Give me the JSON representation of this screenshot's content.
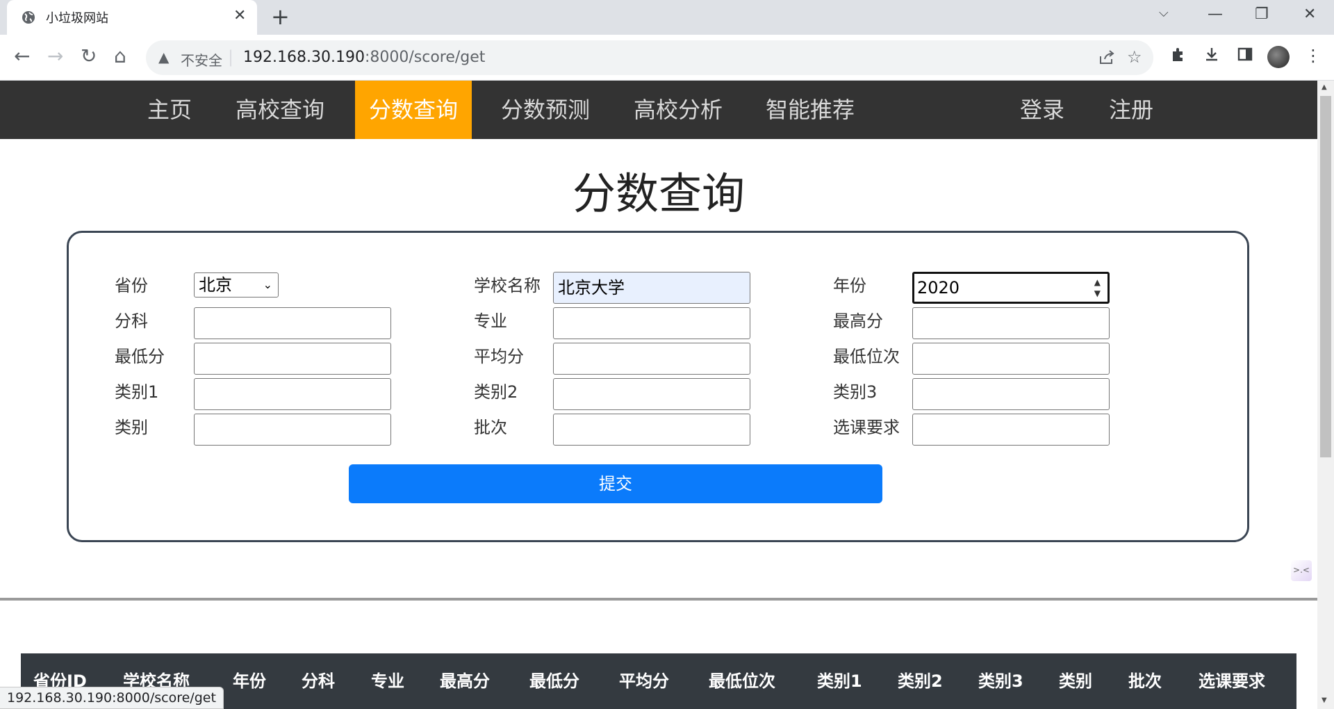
{
  "browser": {
    "tab_title": "小垃圾网站",
    "tab_close": "✕",
    "new_tab": "+",
    "window": {
      "chevron": "⌵",
      "minimize": "—",
      "restore": "❐",
      "close": "✕"
    },
    "nav": {
      "back": "←",
      "forward": "→",
      "reload": "↻",
      "home": "⌂"
    },
    "security_icon": "▲",
    "insecure_label": "不安全",
    "separator": "|",
    "url_host": "192.168.30.190",
    "url_path": ":8000/score/get",
    "status_url": "192.168.30.190:8000/score/get"
  },
  "navbar": {
    "items": [
      "主页",
      "高校查询",
      "分数查询",
      "分数预测",
      "高校分析",
      "智能推荐"
    ],
    "active_index": 2,
    "login": "登录",
    "register": "注册"
  },
  "page_title": "分数查询",
  "form": {
    "labels": {
      "province": "省份",
      "school": "学校名称",
      "year": "年份",
      "subject": "分科",
      "major": "专业",
      "max_score": "最高分",
      "min_score": "最低分",
      "avg_score": "平均分",
      "min_rank": "最低位次",
      "cat1": "类别1",
      "cat2": "类别2",
      "cat3": "类别3",
      "category": "类别",
      "batch": "批次",
      "course_req": "选课要求"
    },
    "values": {
      "province": "北京",
      "school": "北京大学",
      "year": "2020"
    },
    "submit": "提交"
  },
  "table": {
    "headers": [
      "省份ID",
      "学校名称",
      "年份",
      "分科",
      "专业",
      "最高分",
      "最低分",
      "平均分",
      "最低位次",
      "类别1",
      "类别2",
      "类别3",
      "类别",
      "批次",
      "选课要求"
    ]
  },
  "colors": {
    "navbar_bg": "#333333",
    "active_nav": "#ffa500",
    "submit_bg": "#0b7bfb",
    "table_head_bg": "#343a40"
  }
}
